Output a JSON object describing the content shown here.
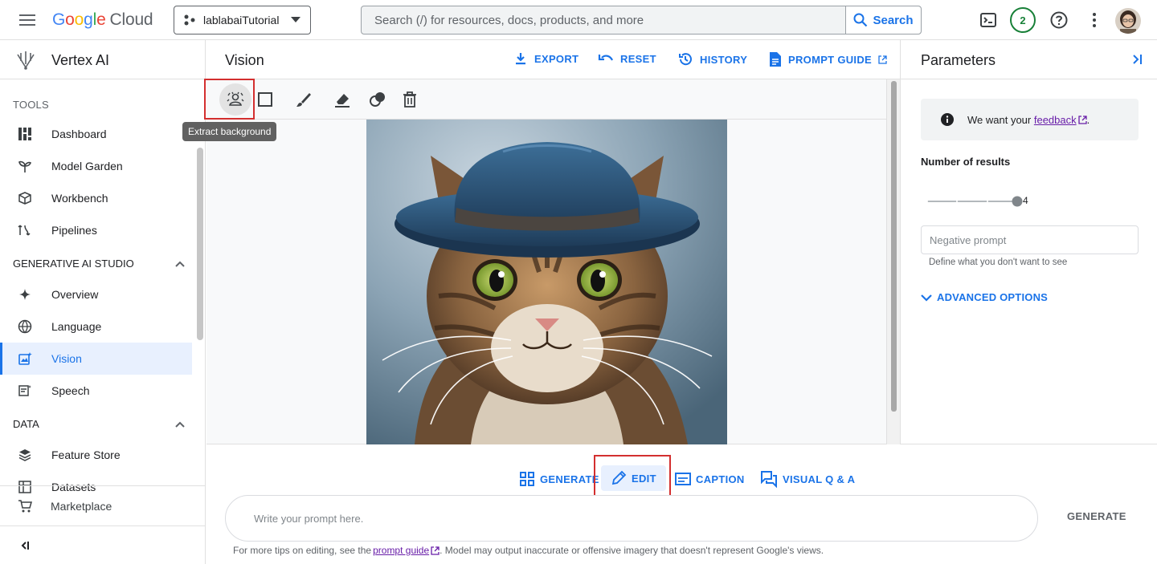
{
  "topbar": {
    "logo_letters": [
      "G",
      "o",
      "o",
      "g",
      "l",
      "e"
    ],
    "logo_cloud": "Cloud",
    "project": "lablabaiTutorial",
    "search_placeholder": "Search (/) for resources, docs, products, and more",
    "search_button": "Search",
    "notifications_count": "2"
  },
  "sidebar": {
    "product": "Vertex AI",
    "tools_label": "TOOLS",
    "tools": [
      {
        "label": "Dashboard",
        "icon": "dashboard-icon"
      },
      {
        "label": "Model Garden",
        "icon": "model-garden-icon"
      },
      {
        "label": "Workbench",
        "icon": "workbench-icon"
      },
      {
        "label": "Pipelines",
        "icon": "pipelines-icon"
      }
    ],
    "genai_label": "GENERATIVE AI STUDIO",
    "genai": [
      {
        "label": "Overview",
        "icon": "sparkle-icon"
      },
      {
        "label": "Language",
        "icon": "language-icon"
      },
      {
        "label": "Vision",
        "icon": "vision-icon",
        "active": true
      },
      {
        "label": "Speech",
        "icon": "speech-icon"
      }
    ],
    "data_label": "DATA",
    "data": [
      {
        "label": "Feature Store",
        "icon": "feature-store-icon"
      },
      {
        "label": "Datasets",
        "icon": "datasets-icon"
      }
    ],
    "marketplace": "Marketplace"
  },
  "main": {
    "title": "Vision",
    "actions": {
      "export": "EXPORT",
      "reset": "RESET",
      "history": "HISTORY",
      "prompt_guide": "PROMPT GUIDE"
    },
    "tooltip": "Extract background"
  },
  "params": {
    "title": "Parameters",
    "feedback_prefix": "We want your ",
    "feedback_link": "feedback",
    "feedback_suffix": ".",
    "results_label": "Number of results",
    "results_value": "4",
    "results_fraction": 1.0,
    "negative_placeholder": "Negative prompt",
    "negative_hint": "Define what you don't want to see",
    "advanced": "ADVANCED OPTIONS"
  },
  "bottom": {
    "modes": {
      "generate": "GENERATE",
      "edit": "EDIT",
      "caption": "CAPTION",
      "vqa": "VISUAL Q & A"
    },
    "prompt_placeholder": "Write your prompt here.",
    "generate_button": "GENERATE",
    "footnote_prefix": "For more tips on editing, see the",
    "footnote_link": "prompt guide",
    "footnote_suffix": ". Model may output inaccurate or offensive imagery that doesn't represent Google's views."
  },
  "colors": {
    "accent": "#1a73e8",
    "highlight": "#d32f2f",
    "badge": "#188038"
  }
}
